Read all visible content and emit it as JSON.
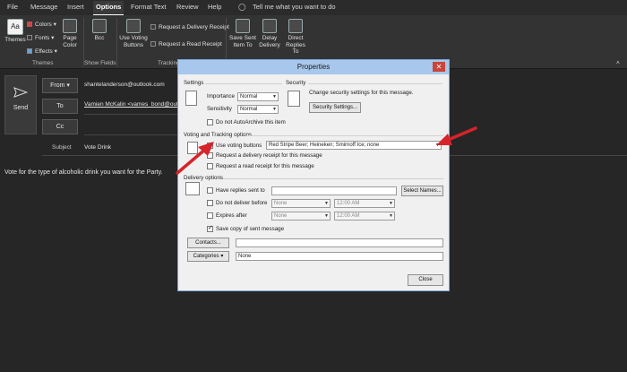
{
  "tabs": [
    "File",
    "Message",
    "Insert",
    "Options",
    "Format Text",
    "Review",
    "Help"
  ],
  "tell_me": "Tell me what you want to do",
  "ribbon": {
    "themes": "Themes",
    "colors": "Colors",
    "fonts": "Fonts",
    "effects": "Effects",
    "page_color": "Page Color",
    "bcc": "Bcc",
    "use_voting": "Use Voting Buttons",
    "request_delivery": "Request a Delivery Receipt",
    "request_read": "Request a Read Receipt",
    "save_sent": "Save Sent Item To",
    "delay_delivery": "Delay Delivery",
    "direct_replies": "Direct Replies To",
    "grp_themes": "Themes",
    "grp_show_fields": "Show Fields",
    "grp_tracking": "Tracking"
  },
  "compose": {
    "send": "Send",
    "from_label": "From",
    "from_value": "shantelanderson@outlook.com",
    "to_label": "To",
    "to_value": "Vamien McKalin <vames_bond@outlo",
    "cc_label": "Cc",
    "subject_label": "Subject",
    "subject_value": "Vote Drink",
    "body": "Vote for the type of alcoholic drink you want for the Party."
  },
  "dialog": {
    "title": "Properties",
    "settings_header": "Settings",
    "importance_label": "Importance",
    "importance_value": "Normal",
    "sensitivity_label": "Sensitivity",
    "sensitivity_value": "Normal",
    "no_autoarchive": "Do not AutoArchive this item",
    "security_header": "Security",
    "security_text": "Change security settings for this message.",
    "security_button": "Security Settings...",
    "voting_header": "Voting and Tracking options",
    "use_voting": "Use voting buttons",
    "voting_value": "Red Stripe Beer; Heineken; Smirnoff Ice; none",
    "req_delivery": "Request a delivery receipt for this message",
    "req_read": "Request a read receipt for this message",
    "delivery_header": "Delivery options",
    "have_replies": "Have replies sent to",
    "select_names": "Select Names...",
    "do_not_deliver": "Do not deliver before",
    "expires_after": "Expires after",
    "date_none": "None",
    "time_value": "12:00 AM",
    "save_copy": "Save copy of sent message",
    "contacts_button": "Contacts...",
    "categories_button": "Categories",
    "categories_value": "None",
    "close_button": "Close"
  },
  "colors": {
    "accent_red": "#d6242a",
    "title_bar": "#a8c7ec"
  }
}
